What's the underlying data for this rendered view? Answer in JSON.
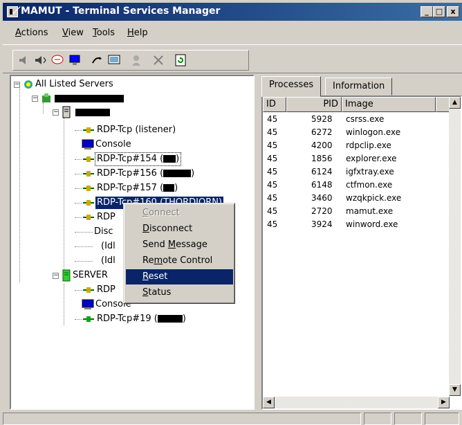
{
  "window": {
    "title": "̸MAMUT - Terminal Services Manager",
    "title_prefix": "̸",
    "title_main": "MAMUT - Terminal Services Manager",
    "minimize": "_",
    "maximize": "□",
    "close": "x"
  },
  "menubar": {
    "items": [
      {
        "label": "Actions",
        "accel": "A",
        "rest": "ctions"
      },
      {
        "label": "View",
        "accel": "V",
        "rest": "iew"
      },
      {
        "label": "Tools",
        "accel": "T",
        "rest": "ools"
      },
      {
        "label": "Help",
        "accel": "H",
        "rest": "elp"
      }
    ]
  },
  "tree": {
    "root": {
      "label": "All Listed Servers"
    },
    "server1": {
      "children": [
        {
          "label": "RDP-Tcp (listener)"
        },
        {
          "label": "Console"
        },
        {
          "label": "RDP-Tcp#154 (",
          "suffix": ")"
        },
        {
          "label": "RDP-Tcp#156 (",
          "suffix": ")"
        },
        {
          "label": "RDP-Tcp#157 (",
          "suffix": ")"
        },
        {
          "label": "RDP-Tcp#160 (THORDJORN)"
        },
        {
          "label": "RDP"
        },
        {
          "label": "Disc"
        },
        {
          "label": "(Idl"
        },
        {
          "label": "(Idl"
        }
      ]
    },
    "server2": {
      "label": "SERVER",
      "children": [
        {
          "label": "RDP"
        },
        {
          "label": "Console"
        },
        {
          "label": "RDP-Tcp#19 (",
          "suffix": ")"
        }
      ]
    }
  },
  "context_menu": {
    "items": [
      {
        "label": "Connect",
        "accel": "C",
        "rest": "onnect",
        "disabled": true
      },
      {
        "label": "Disconnect",
        "accel": "D",
        "rest": "isconnect"
      },
      {
        "label": "Send Message",
        "accel": "M",
        "pre": "Send ",
        "rest": "essage"
      },
      {
        "label": "Remote Control",
        "accel": "m",
        "pre": "Re",
        "rest": "ote Control"
      },
      {
        "label": "Reset",
        "accel": "R",
        "rest": "eset",
        "highlighted": true
      },
      {
        "label": "Status",
        "accel": "S",
        "rest": "tatus"
      }
    ]
  },
  "tabs": [
    {
      "label": "Processes",
      "active": true
    },
    {
      "label": "Information",
      "active": false
    }
  ],
  "processes": {
    "columns": [
      "ID",
      "PID",
      "Image"
    ],
    "rows": [
      {
        "id": "45",
        "pid": "5928",
        "image": "csrss.exe"
      },
      {
        "id": "45",
        "pid": "6272",
        "image": "winlogon.exe"
      },
      {
        "id": "45",
        "pid": "4200",
        "image": "rdpclip.exe"
      },
      {
        "id": "45",
        "pid": "1856",
        "image": "explorer.exe"
      },
      {
        "id": "45",
        "pid": "6124",
        "image": "igfxtray.exe"
      },
      {
        "id": "45",
        "pid": "6148",
        "image": "ctfmon.exe"
      },
      {
        "id": "45",
        "pid": "3460",
        "image": "wzqkpick.exe"
      },
      {
        "id": "45",
        "pid": "2720",
        "image": "mamut.exe"
      },
      {
        "id": "45",
        "pid": "3924",
        "image": "winword.exe"
      }
    ]
  },
  "colors": {
    "selection": "#0a246a",
    "face": "#d4d0c8",
    "title_start": "#0a246a",
    "title_end": "#3a6ea5"
  }
}
